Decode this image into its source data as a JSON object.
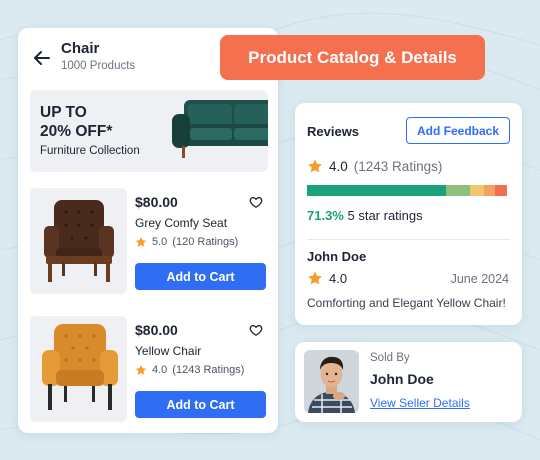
{
  "header": {
    "title": "Product Catalog & Details"
  },
  "catalog": {
    "title": "Chair",
    "subtitle": "1000 Products",
    "promo": {
      "line1": "UP TO",
      "line2": "20% OFF*",
      "subtitle": "Furniture Collection"
    },
    "products": [
      {
        "price": "$80.00",
        "name": "Grey Comfy Seat",
        "rating": "5.0",
        "rating_count": "(120 Ratings)",
        "cart_label": "Add to Cart"
      },
      {
        "price": "$80.00",
        "name": "Yellow Chair",
        "rating": "4.0",
        "rating_count": "(1243 Ratings)",
        "cart_label": "Add to Cart"
      }
    ]
  },
  "reviews": {
    "title": "Reviews",
    "feedback_label": "Add Feedback",
    "average": "4.0",
    "count": "(1243 Ratings)",
    "distribution_colors": [
      "#1aa37a",
      "#8dc07a",
      "#f2c66b",
      "#f4a261",
      "#ef6f4f"
    ],
    "distribution": [
      0.713,
      0.12,
      0.07,
      0.06,
      0.06
    ],
    "five_star_pct": "71.3%",
    "five_star_label": "5 star ratings",
    "review": {
      "name": "John Doe",
      "rating": "4.0",
      "date": "June 2024",
      "text": "Comforting and Elegant Yellow Chair!"
    }
  },
  "seller": {
    "sold_by": "Sold By",
    "name": "John Doe",
    "link_label": "View Seller Details"
  },
  "colors": {
    "accent": "#2f6ef4",
    "header": "#f4704f",
    "star": "#f59e2c",
    "positive": "#1aa37a"
  }
}
